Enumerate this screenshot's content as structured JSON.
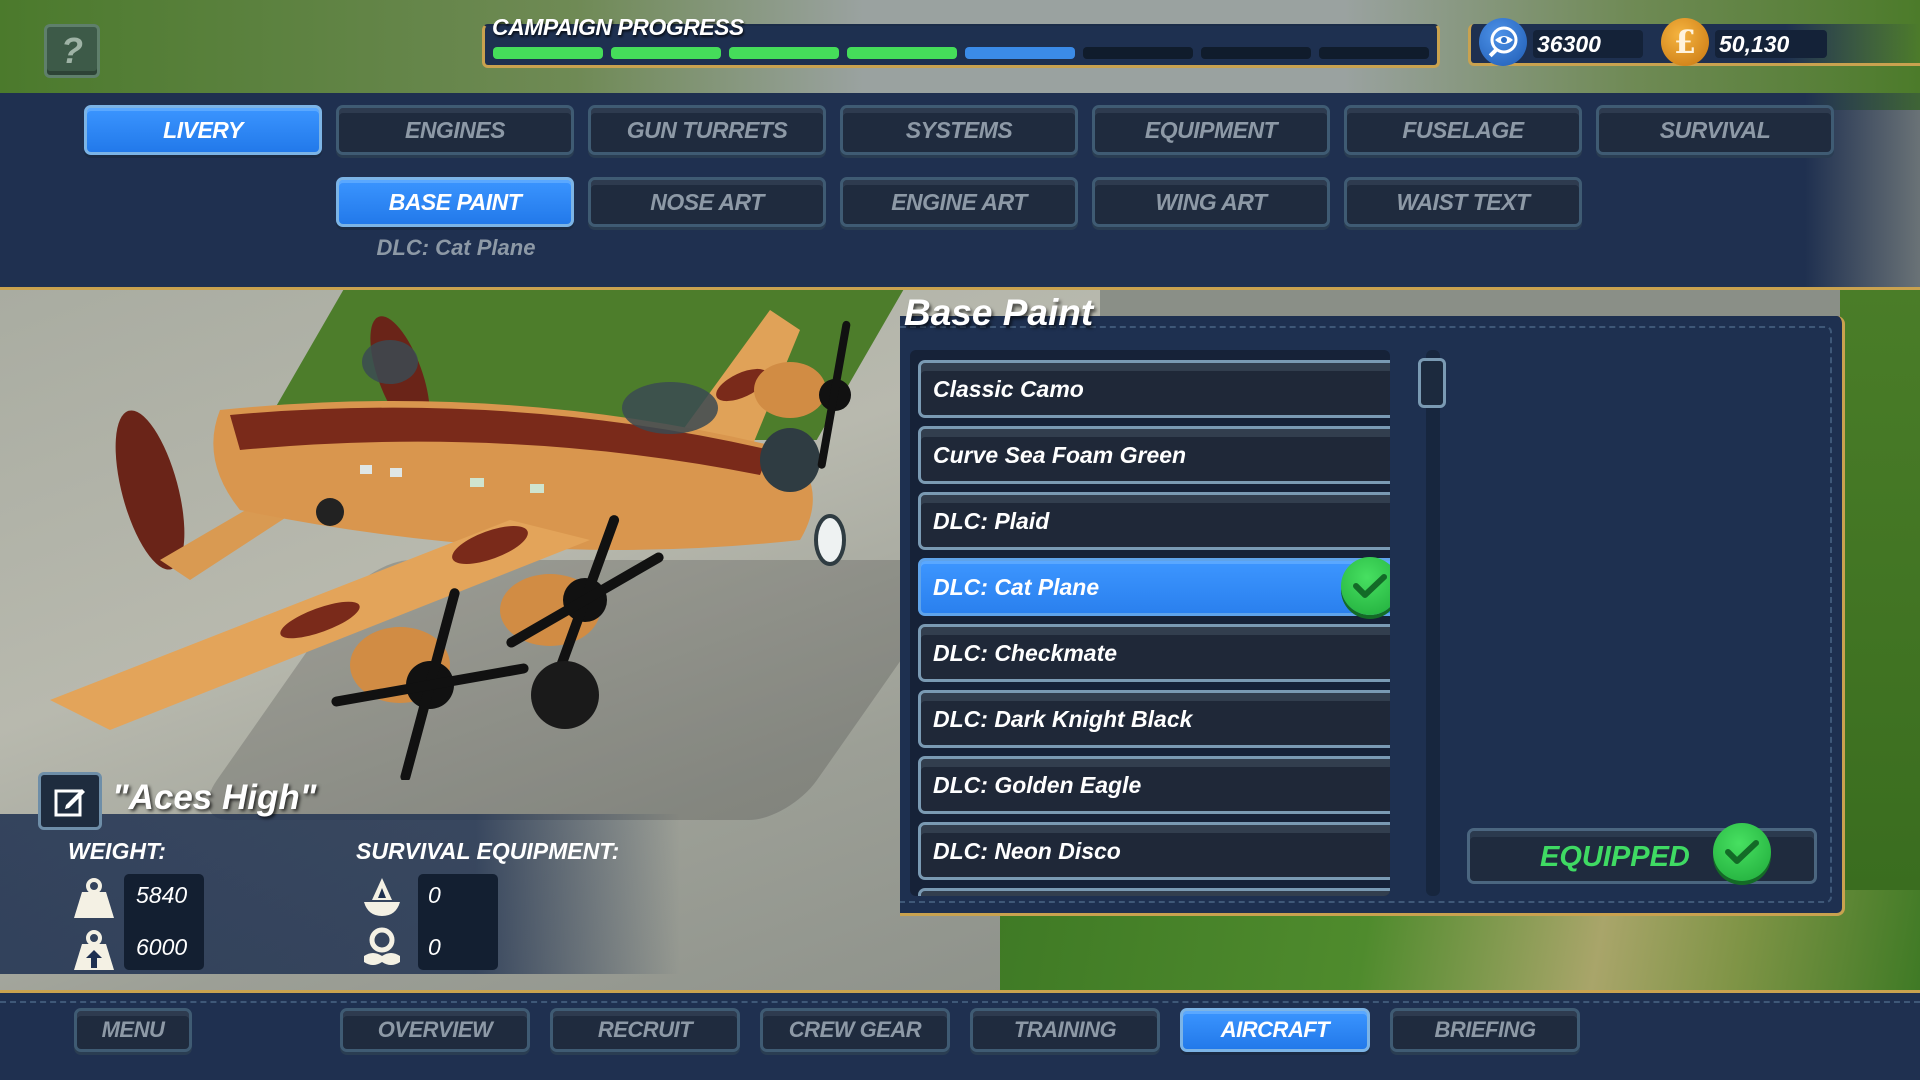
{
  "hud": {
    "help_label": "?",
    "campaign": {
      "title": "CAMPAIGN PROGRESS",
      "segments_total": 8,
      "segments_completed": 4,
      "segment_current": 5
    },
    "currency": {
      "intel_icon": "intel-eye-icon",
      "intel_value": "36300",
      "money_icon": "pound-coin-icon",
      "money_symbol": "£",
      "money_value": "50,130"
    }
  },
  "categories": {
    "tabs": [
      {
        "label": "LIVERY",
        "active": true
      },
      {
        "label": "ENGINES",
        "active": false
      },
      {
        "label": "GUN TURRETS",
        "active": false
      },
      {
        "label": "SYSTEMS",
        "active": false
      },
      {
        "label": "EQUIPMENT",
        "active": false
      },
      {
        "label": "FUSELAGE",
        "active": false
      },
      {
        "label": "SURVIVAL",
        "active": false
      }
    ],
    "subtabs": [
      {
        "label": "BASE PAINT",
        "active": true
      },
      {
        "label": "NOSE ART",
        "active": false
      },
      {
        "label": "ENGINE ART",
        "active": false
      },
      {
        "label": "WING ART",
        "active": false
      },
      {
        "label": "WAIST TEXT",
        "active": false
      }
    ],
    "subtab_note": "DLC: Cat Plane"
  },
  "paint": {
    "title": "Base Paint",
    "items": [
      {
        "label": "Classic Camo",
        "selected": false
      },
      {
        "label": "Curve Sea Foam Green",
        "selected": false
      },
      {
        "label": "DLC: Plaid",
        "selected": false
      },
      {
        "label": "DLC: Cat Plane",
        "selected": true,
        "equipped": true
      },
      {
        "label": "DLC: Checkmate",
        "selected": false
      },
      {
        "label": "DLC: Dark Knight Black",
        "selected": false
      },
      {
        "label": "DLC: Golden Eagle",
        "selected": false
      },
      {
        "label": "DLC: Neon Disco",
        "selected": false
      },
      {
        "label": "",
        "selected": false,
        "partial": true
      }
    ],
    "equipped_label": "EQUIPPED",
    "colors": {
      "accent_blue": "#2a80ee",
      "equipped_green": "#3fda63",
      "gold_trim": "#c9a24f",
      "panel_navy": "#1e3050"
    }
  },
  "aircraft": {
    "name": "\"Aces High\"",
    "weight_label": "WEIGHT:",
    "weight_current": "5840",
    "weight_max": "6000",
    "survival_label": "SURVIVAL EQUIPMENT:",
    "dinghy_count": "0",
    "lifejacket_count": "0"
  },
  "nav": {
    "menu": "MENU",
    "tabs": [
      {
        "label": "OVERVIEW",
        "active": false
      },
      {
        "label": "RECRUIT",
        "active": false
      },
      {
        "label": "CREW GEAR",
        "active": false
      },
      {
        "label": "TRAINING",
        "active": false
      },
      {
        "label": "AIRCRAFT",
        "active": true
      },
      {
        "label": "BRIEFING",
        "active": false
      }
    ]
  }
}
